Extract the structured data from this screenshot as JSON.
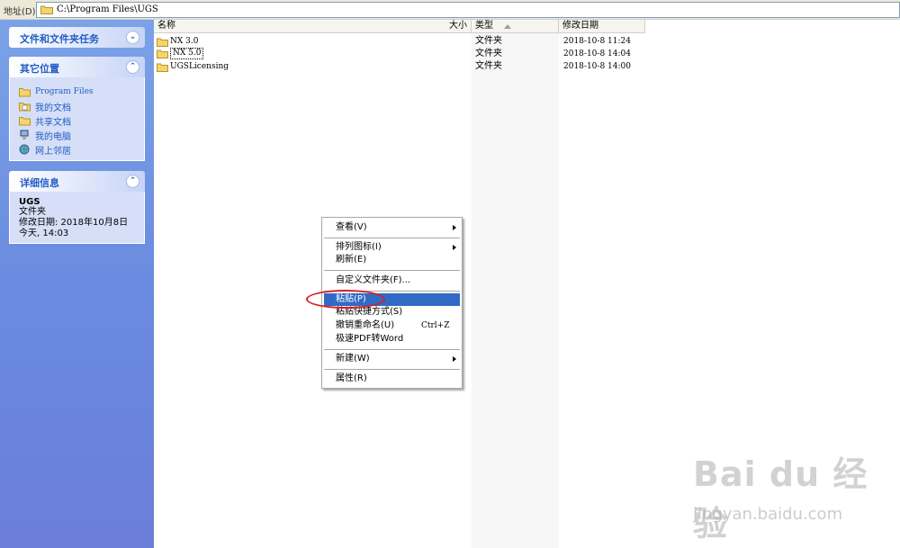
{
  "address": {
    "label": "地址(D)",
    "path": "C:\\Program Files\\UGS"
  },
  "taskpane": {
    "tasks": {
      "title": "文件和文件夹任务"
    },
    "places": {
      "title": "其它位置",
      "items": [
        "Program Files",
        "我的文档",
        "共享文档",
        "我的电脑",
        "网上邻居"
      ]
    },
    "details": {
      "title": "详细信息",
      "name": "UGS",
      "kind": "文件夹",
      "modified": "修改日期: 2018年10月8日",
      "today": "今天, 14:03"
    }
  },
  "columns": {
    "name": "名称",
    "size": "大小",
    "type": "类型",
    "date": "修改日期"
  },
  "files": [
    {
      "name": "NX 3.0",
      "type": "文件夹",
      "date": "2018-10-8 11:24"
    },
    {
      "name": "NX 5.0",
      "type": "文件夹",
      "date": "2018-10-8 14:04"
    },
    {
      "name": "UGSLicensing",
      "type": "文件夹",
      "date": "2018-10-8 14:00"
    }
  ],
  "menu": {
    "view": "查看(V)",
    "arrange": "排列图标(I)",
    "refresh": "刷新(E)",
    "customize": "自定义文件夹(F)...",
    "paste": "粘贴(P)",
    "paste_shortcut": "粘贴快捷方式(S)",
    "undo_rename": "撤销重命名(U)",
    "undo_shortcut": "Ctrl+Z",
    "pdf_to_word": "极速PDF转Word",
    "new": "新建(W)",
    "properties": "属性(R)"
  },
  "watermark": {
    "brand": "Bai du 经验",
    "site": "jingyan.baidu.com"
  },
  "colors": {
    "taskpane": "#6a8be0",
    "highlight": "#316ac5",
    "annotation": "#d41f26"
  }
}
